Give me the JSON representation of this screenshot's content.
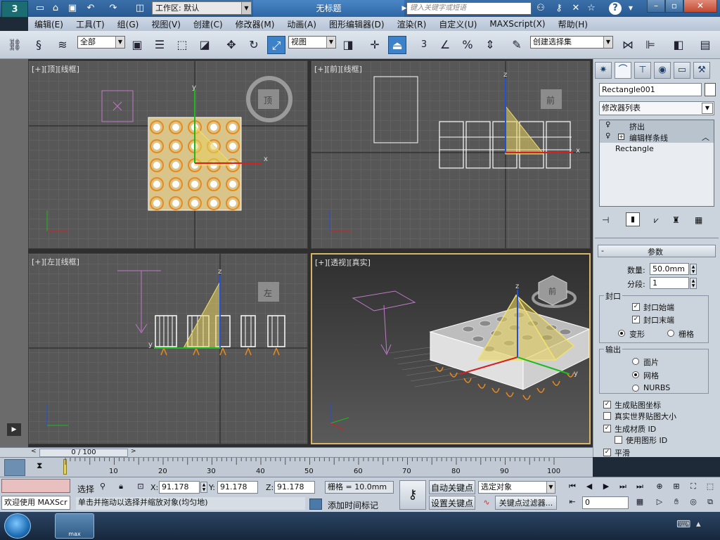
{
  "app": {
    "logo_text": "3",
    "workspace_label": "工作区: 默认",
    "doc_title": "无标题",
    "search_placeholder": "键入关键字或短语"
  },
  "menu": [
    "编辑(E)",
    "工具(T)",
    "组(G)",
    "视图(V)",
    "创建(C)",
    "修改器(M)",
    "动画(A)",
    "图形编辑器(D)",
    "渲染(R)",
    "自定义(U)",
    "MAXScript(X)",
    "帮助(H)"
  ],
  "toolbar": {
    "filter_value": "全部",
    "ref_coord_value": "视图",
    "named_selection": "创建选择集",
    "snap_label": "3"
  },
  "viewports": {
    "top": "[+][顶][线框]",
    "front": "[+][前][线框]",
    "left": "[+][左][线框]",
    "persp": "[+][透视][真实]",
    "cube_top": "顶",
    "cube_front": "前",
    "cube_left": "左",
    "cube_persp": "前",
    "axis_x": "x",
    "axis_y": "y",
    "axis_z": "z"
  },
  "command_panel": {
    "object_name": "Rectangle001",
    "object_color": "#ffffff",
    "modifier_list": "修改器列表",
    "stack": [
      "挤出",
      "编辑样条线",
      "Rectangle"
    ],
    "rollout_title": "参数",
    "amount_label": "数量:",
    "amount_value": "50.0mm",
    "segments_label": "分段:",
    "segments_value": "1",
    "capping_title": "封口",
    "cap_start": "封口始端",
    "cap_end": "封口末端",
    "morph": "变形",
    "grid": "栅格",
    "output_title": "输出",
    "patch": "面片",
    "mesh": "网格",
    "nurbs": "NURBS",
    "gen_map": "生成贴图坐标",
    "real_world": "真实世界贴图大小",
    "gen_mat": "生成材质 ID",
    "use_shape": "使用图形 ID",
    "smooth": "平滑",
    "collapse_sign": "-"
  },
  "timeline": {
    "frame_label": "0 / 100",
    "ticks": [
      "10",
      "20",
      "30",
      "40",
      "50",
      "60",
      "70",
      "80",
      "90",
      "100"
    ]
  },
  "status": {
    "mode": "选择",
    "x_label": "X:",
    "x_value": "91.178",
    "y_label": "Y:",
    "y_value": "91.178",
    "z_label": "Z:",
    "z_value": "91.178",
    "grid_value": "栅格 = 10.0mm",
    "auto_key": "自动关键点",
    "set_key": "设置关键点",
    "selected_object": "选定对象",
    "key_filter": "关键点过滤器...",
    "frame_value": "0",
    "add_tag": "添加时间标记",
    "prompt": "单击并拖动以选择并缩放对象(均匀地)",
    "welcome": "欢迎使用 MAXScr"
  },
  "taskbar": {
    "app_label": "max"
  }
}
